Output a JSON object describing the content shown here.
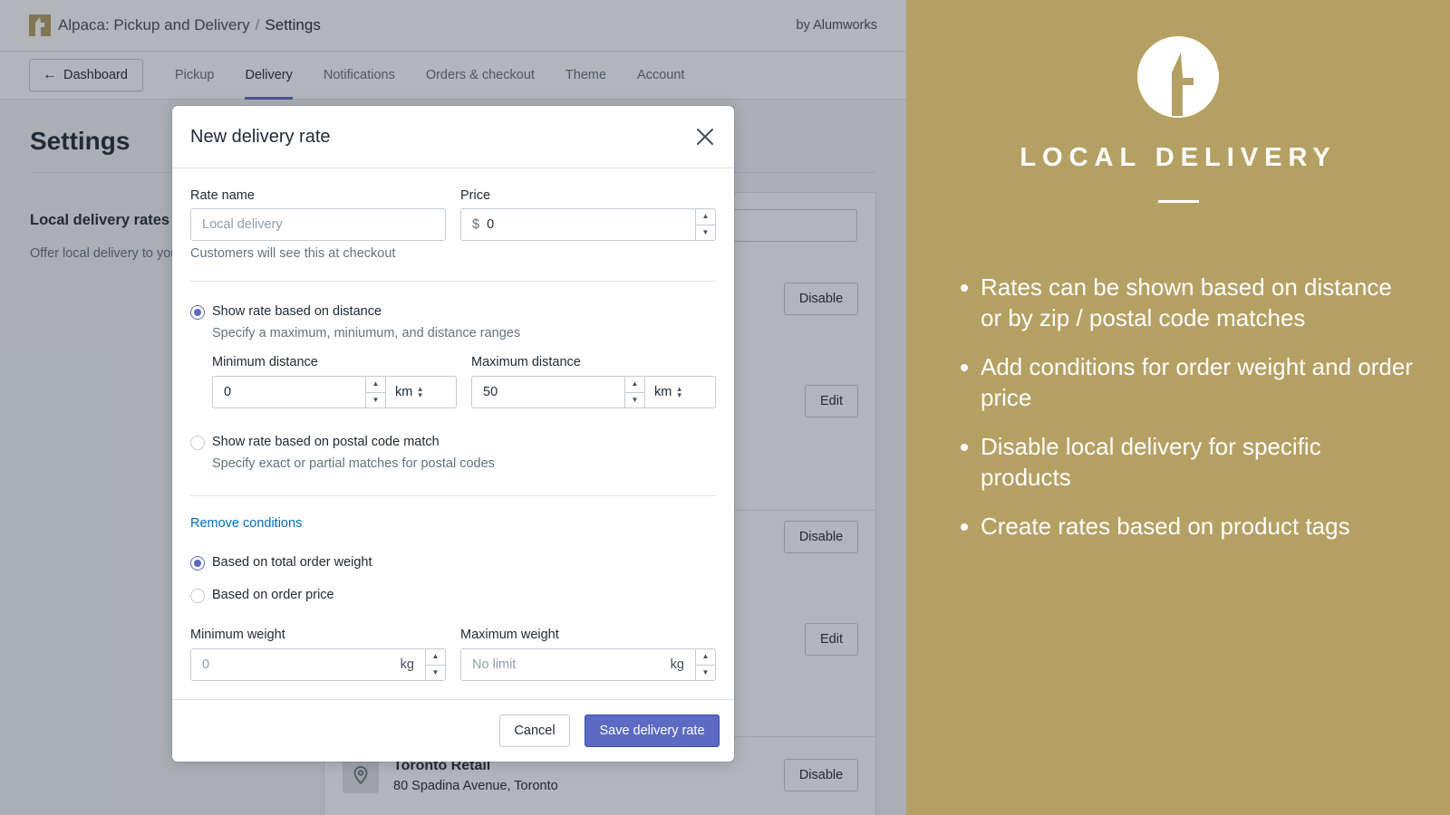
{
  "app": {
    "breadcrumb_app": "Alpaca: Pickup and Delivery",
    "breadcrumb_sep": "/",
    "breadcrumb_page": "Settings",
    "byline": "by Alumworks"
  },
  "nav": {
    "back_label": "Dashboard",
    "tabs": [
      {
        "label": "Pickup",
        "active": false
      },
      {
        "label": "Delivery",
        "active": true
      },
      {
        "label": "Notifications",
        "active": false
      },
      {
        "label": "Orders & checkout",
        "active": false
      },
      {
        "label": "Theme",
        "active": false
      },
      {
        "label": "Account",
        "active": false
      }
    ]
  },
  "page": {
    "title": "Settings",
    "section_title": "Local delivery rates",
    "section_desc": "Offer local delivery to your customers"
  },
  "background": {
    "buttons": [
      "Disable",
      "Edit",
      "Disable",
      "Edit",
      "Disable"
    ],
    "location_name": "Toronto Retail",
    "location_address": "80 Spadina Avenue, Toronto"
  },
  "modal": {
    "title": "New delivery rate",
    "rate_name_label": "Rate name",
    "rate_name_placeholder": "Local delivery",
    "rate_name_hint": "Customers will see this at checkout",
    "price_label": "Price",
    "price_prefix": "$",
    "price_value": "0",
    "option_distance_label": "Show rate based on distance",
    "option_distance_hint": "Specify a maximum, miniumum, and distance ranges",
    "min_distance_label": "Minimum distance",
    "min_distance_value": "0",
    "max_distance_label": "Maximum distance",
    "max_distance_value": "50",
    "distance_unit": "km",
    "option_postal_label": "Show rate based on postal code match",
    "option_postal_hint": "Specify exact or partial matches for postal codes",
    "remove_conditions": "Remove conditions",
    "cond_weight_label": "Based on total order weight",
    "cond_price_label": "Based on order price",
    "min_weight_label": "Minimum weight",
    "min_weight_placeholder": "0",
    "max_weight_label": "Maximum weight",
    "max_weight_placeholder": "No limit",
    "weight_unit": "kg",
    "cancel_label": "Cancel",
    "save_label": "Save delivery rate"
  },
  "promo": {
    "title": "LOCAL DELIVERY",
    "bullets": [
      "Rates can be shown based on distance or by zip / postal code matches",
      "Add conditions for order weight and order price",
      "Disable local delivery for specific products",
      "Create rates based on product tags"
    ]
  },
  "colors": {
    "accent": "#5c6ac4",
    "brand_gold": "#b5a064",
    "link": "#006fbb"
  },
  "icons": {
    "back": "arrow-left-icon",
    "close": "close-icon",
    "location": "location-pin-icon",
    "logo": "alpaca-logo"
  }
}
